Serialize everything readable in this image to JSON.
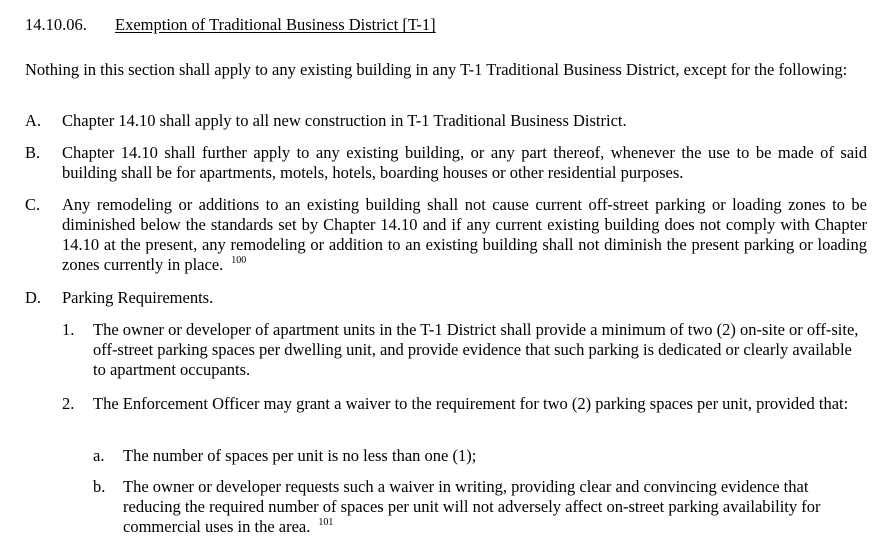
{
  "section": {
    "number": "14.10.06.",
    "title": "Exemption of Traditional Business District [T-1]"
  },
  "intro": "Nothing in this section shall apply to any existing building in any T-1 Traditional Business District, except for the following:",
  "items": [
    {
      "marker": "A.",
      "text": "Chapter 14.10 shall apply to all new construction in T-1 Traditional Business District."
    },
    {
      "marker": "B.",
      "text": "Chapter 14.10 shall further apply to any existing building, or any part thereof, whenever the use to be made of said building shall be for apartments, motels, hotels, boarding houses or other residential purposes."
    },
    {
      "marker": "C.",
      "text": "Any remodeling or additions to an existing building shall not cause current off-street parking or loading zones to be diminished below the standards set by Chapter 14.10 and if any current existing building does not comply with Chapter 14.10 at the present, any remodeling or addition to an existing building shall not diminish the present parking or loading zones currently in place.",
      "footnote": "100"
    },
    {
      "marker": "D.",
      "text": "Parking Requirements."
    }
  ],
  "parking": [
    {
      "marker": "1.",
      "text": "The owner or developer of apartment units in the T-1 District shall provide a minimum of two (2) on-site or off-site, off-street parking spaces per dwelling unit, and provide evidence that such parking is dedicated or clearly available to apartment occupants."
    },
    {
      "marker": "2.",
      "text": "The Enforcement Officer may grant a waiver to the requirement for two (2) parking spaces per unit, provided that:"
    }
  ],
  "waiver_conditions": [
    {
      "marker": "a.",
      "text": "The number of spaces per unit is no less than one (1);"
    },
    {
      "marker": "b.",
      "text": "The owner or developer requests such a waiver in writing, providing clear and convincing evidence that reducing the required number of spaces per unit will not adversely affect on-street parking availability for commercial uses in the area.",
      "footnote": "101"
    }
  ]
}
